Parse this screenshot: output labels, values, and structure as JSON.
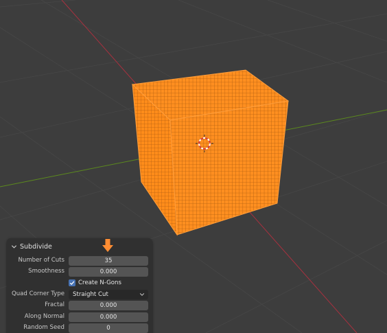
{
  "panel": {
    "title": "Subdivide",
    "number_of_cuts": {
      "label": "Number of Cuts",
      "value": "35"
    },
    "smoothness": {
      "label": "Smoothness",
      "value": "0.000"
    },
    "create_ngons": {
      "label": "Create N-Gons",
      "checked": true
    },
    "quad_corner_type": {
      "label": "Quad Corner Type",
      "value": "Straight Cut"
    },
    "fractal": {
      "label": "Fractal",
      "value": "0.000"
    },
    "along_normal": {
      "label": "Along Normal",
      "value": "0.000"
    },
    "random_seed": {
      "label": "Random Seed",
      "value": "0"
    }
  },
  "colors": {
    "mesh_selected": "#ff8c1a",
    "x_axis": "#a8313f",
    "y_axis": "#5c8a1e",
    "checkbox_accent": "#4772b3",
    "drag_arrow": "#ff8d33"
  },
  "icons": {
    "panel_toggle": "chevron-down-icon",
    "cursor": "3d-cursor-icon",
    "drag_indicator": "arrow-down-icon"
  }
}
